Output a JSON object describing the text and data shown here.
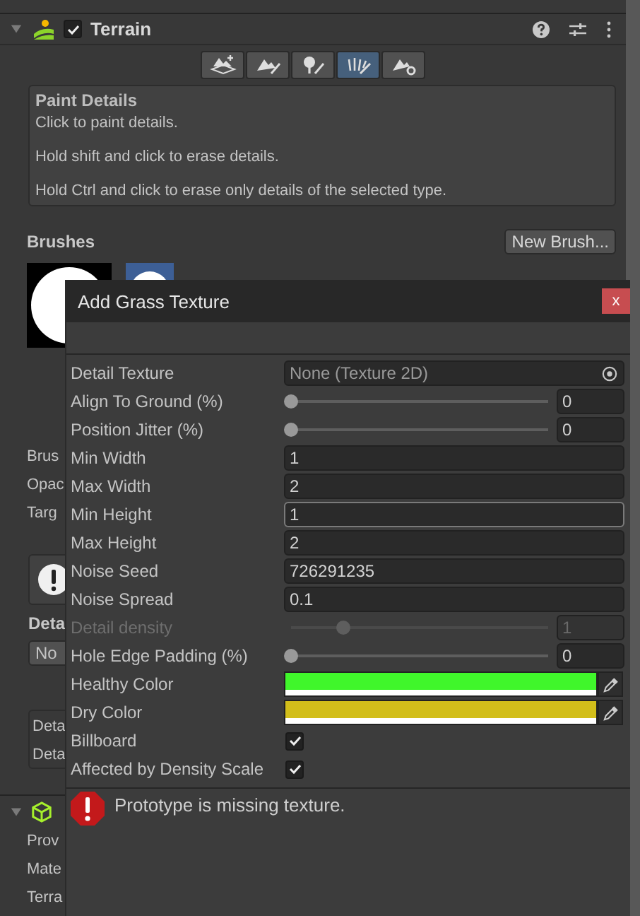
{
  "inspector": {
    "component": {
      "title": "Terrain",
      "expanded": true,
      "enabled": true
    },
    "tools": [
      {
        "kind": "create",
        "selected": false
      },
      {
        "kind": "sculpt",
        "selected": false
      },
      {
        "kind": "trees",
        "selected": false
      },
      {
        "kind": "details",
        "selected": true
      },
      {
        "kind": "settings",
        "selected": false
      }
    ],
    "help": {
      "title": "Paint Details",
      "lines": [
        "Click to paint details.",
        "Hold shift and click to erase details.",
        "Hold Ctrl and click to erase only details of the selected type."
      ]
    },
    "brushes": {
      "label": "Brushes",
      "button": "New Brush..."
    },
    "covered_labels": [
      "Brus",
      "Opac",
      "Targ"
    ],
    "details_label": "Deta",
    "dropdown": "No",
    "details_box": [
      "Deta",
      "Deta"
    ],
    "next_component": {
      "expanded": true,
      "labels": [
        "Prov",
        "Mate",
        "Terra"
      ]
    }
  },
  "dialog": {
    "title": "Add Grass Texture",
    "close": "x",
    "fields": [
      {
        "kind": "object",
        "label": "Detail Texture",
        "value": "None (Texture 2D)",
        "disabled": false
      },
      {
        "kind": "slider",
        "label": "Align To Ground (%)",
        "level": 0,
        "value": "0",
        "disabled": false
      },
      {
        "kind": "slider",
        "label": "Position Jitter (%)",
        "level": 0,
        "value": "0",
        "disabled": false
      },
      {
        "kind": "text",
        "label": "Min Width",
        "value": "1",
        "focused": false,
        "disabled": false
      },
      {
        "kind": "text",
        "label": "Max Width",
        "value": "2",
        "focused": false,
        "disabled": false
      },
      {
        "kind": "text",
        "label": "Min Height",
        "value": "1",
        "focused": true,
        "disabled": false
      },
      {
        "kind": "text",
        "label": "Max Height",
        "value": "2",
        "focused": false,
        "disabled": false
      },
      {
        "kind": "text",
        "label": "Noise Seed",
        "value": "726291235",
        "focused": false,
        "disabled": false
      },
      {
        "kind": "text",
        "label": "Noise Spread",
        "value": "0.1",
        "focused": false,
        "disabled": false
      },
      {
        "kind": "slider",
        "label": "Detail density",
        "level": 0.2,
        "value": "1",
        "disabled": true
      },
      {
        "kind": "slider",
        "label": "Hole Edge Padding (%)",
        "level": 0,
        "value": "0",
        "disabled": false
      },
      {
        "kind": "color",
        "label": "Healthy Color",
        "color": "#40f62b",
        "disabled": false
      },
      {
        "kind": "color",
        "label": "Dry Color",
        "color": "#d2be1a",
        "disabled": false
      },
      {
        "kind": "checkbox",
        "label": "Billboard",
        "checked": true,
        "disabled": false
      },
      {
        "kind": "checkbox",
        "label": "Affected by Density Scale",
        "checked": true,
        "disabled": false
      }
    ],
    "error": "Prototype is missing texture."
  }
}
